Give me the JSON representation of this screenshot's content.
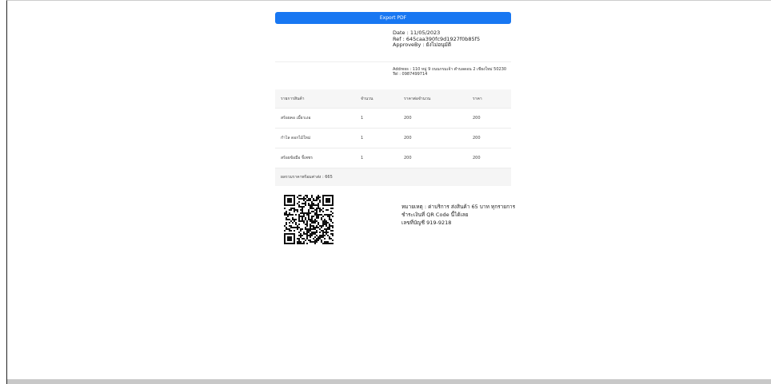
{
  "toolbar": {
    "export_label": "Export PDF"
  },
  "info": {
    "date": "Date : 11/05/2023",
    "ref": "Ref : 645caa390fc9d1927f0b85f5",
    "approve": "ApproveBy : ยังไม่อนุมัติ"
  },
  "contact": {
    "address": "Address : 110 หมู่ 9 ถนนกรมเจ้า ตำบลดอน 2 เชียงใหม่ 50230",
    "tel": "Tel : 0987499714"
  },
  "table": {
    "headers": [
      "รายการสินค้า",
      "จำนวน",
      "ราคาต่อจำนวน",
      "ราคา"
    ],
    "rows": [
      [
        "สร้อยคอ เมี้ยวเงอ",
        "1",
        "200",
        "200"
      ],
      [
        "กำไล ดอกไม้ใหม่",
        "1",
        "200",
        "200"
      ],
      [
        "สร้อยข้อมือ จี้เพชร",
        "1",
        "200",
        "200"
      ]
    ],
    "total": "ผลรวมราคาพร้อมค่าส่ง : 665"
  },
  "note": {
    "line1": "หมายเหตุ : ค่าบริการ ส่งสินค้า 65 บาท ทุกรายการ",
    "line2": "ชำระเงินที่ QR Code นี้ได้เลย",
    "line3": "เลขที่บัญชี 919-9218"
  }
}
